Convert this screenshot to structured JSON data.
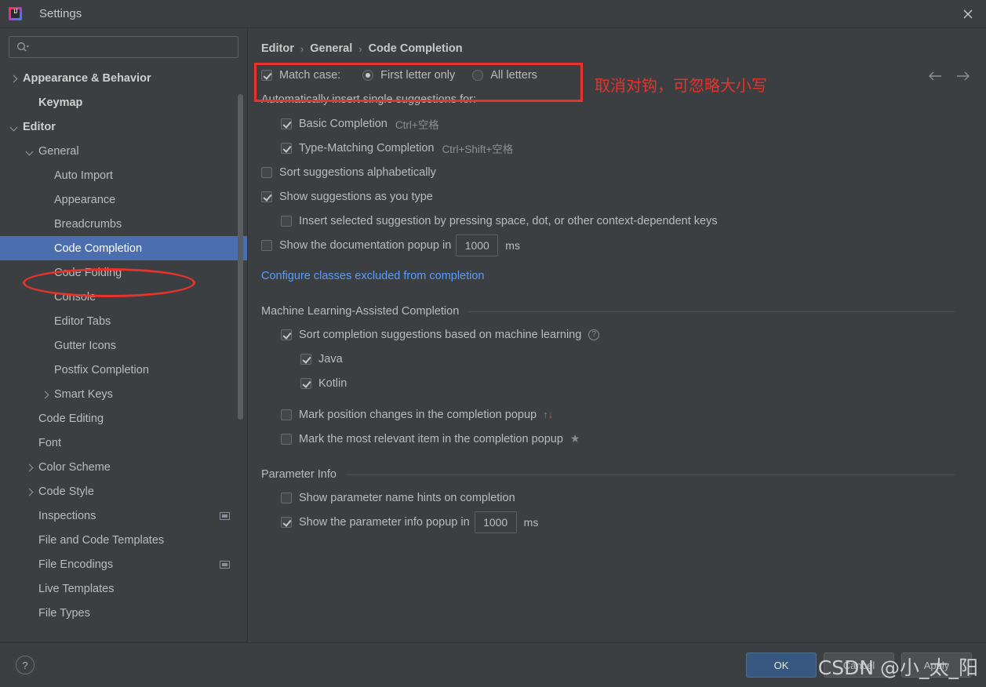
{
  "window": {
    "title": "Settings",
    "app_icon": "intellij-idea-icon",
    "close_icon": "close-icon"
  },
  "sidebar": {
    "search": {
      "placeholder": "",
      "value": "",
      "icon": "search-icon"
    },
    "items": [
      {
        "label": "Appearance & Behavior",
        "arrow": "right",
        "indent": 0,
        "bold": true,
        "selected": false,
        "scope_icon": false
      },
      {
        "label": "Keymap",
        "arrow": "none",
        "indent": 1,
        "bold": true,
        "selected": false,
        "scope_icon": false
      },
      {
        "label": "Editor",
        "arrow": "down",
        "indent": 0,
        "bold": true,
        "selected": false,
        "scope_icon": false
      },
      {
        "label": "General",
        "arrow": "down",
        "indent": 1,
        "bold": false,
        "selected": false,
        "scope_icon": false
      },
      {
        "label": "Auto Import",
        "arrow": "none",
        "indent": 2,
        "bold": false,
        "selected": false,
        "scope_icon": false
      },
      {
        "label": "Appearance",
        "arrow": "none",
        "indent": 2,
        "bold": false,
        "selected": false,
        "scope_icon": false
      },
      {
        "label": "Breadcrumbs",
        "arrow": "none",
        "indent": 2,
        "bold": false,
        "selected": false,
        "scope_icon": false
      },
      {
        "label": "Code Completion",
        "arrow": "none",
        "indent": 2,
        "bold": false,
        "selected": true,
        "scope_icon": false
      },
      {
        "label": "Code Folding",
        "arrow": "none",
        "indent": 2,
        "bold": false,
        "selected": false,
        "scope_icon": false
      },
      {
        "label": "Console",
        "arrow": "none",
        "indent": 2,
        "bold": false,
        "selected": false,
        "scope_icon": false
      },
      {
        "label": "Editor Tabs",
        "arrow": "none",
        "indent": 2,
        "bold": false,
        "selected": false,
        "scope_icon": false
      },
      {
        "label": "Gutter Icons",
        "arrow": "none",
        "indent": 2,
        "bold": false,
        "selected": false,
        "scope_icon": false
      },
      {
        "label": "Postfix Completion",
        "arrow": "none",
        "indent": 2,
        "bold": false,
        "selected": false,
        "scope_icon": false
      },
      {
        "label": "Smart Keys",
        "arrow": "right",
        "indent": 2,
        "bold": false,
        "selected": false,
        "scope_icon": false
      },
      {
        "label": "Code Editing",
        "arrow": "none",
        "indent": 1,
        "bold": false,
        "selected": false,
        "scope_icon": false
      },
      {
        "label": "Font",
        "arrow": "none",
        "indent": 1,
        "bold": false,
        "selected": false,
        "scope_icon": false
      },
      {
        "label": "Color Scheme",
        "arrow": "right",
        "indent": 1,
        "bold": false,
        "selected": false,
        "scope_icon": false
      },
      {
        "label": "Code Style",
        "arrow": "right",
        "indent": 1,
        "bold": false,
        "selected": false,
        "scope_icon": false
      },
      {
        "label": "Inspections",
        "arrow": "none",
        "indent": 1,
        "bold": false,
        "selected": false,
        "scope_icon": true
      },
      {
        "label": "File and Code Templates",
        "arrow": "none",
        "indent": 1,
        "bold": false,
        "selected": false,
        "scope_icon": false
      },
      {
        "label": "File Encodings",
        "arrow": "none",
        "indent": 1,
        "bold": false,
        "selected": false,
        "scope_icon": true
      },
      {
        "label": "Live Templates",
        "arrow": "none",
        "indent": 1,
        "bold": false,
        "selected": false,
        "scope_icon": false
      },
      {
        "label": "File Types",
        "arrow": "none",
        "indent": 1,
        "bold": false,
        "selected": false,
        "scope_icon": false
      }
    ]
  },
  "content": {
    "breadcrumb": [
      "Editor",
      "General",
      "Code Completion"
    ],
    "breadcrumb_separator": "›",
    "nav": {
      "back_icon": "arrow-left-icon",
      "forward_icon": "arrow-right-icon"
    },
    "match_case": {
      "label": "Match case:",
      "checked": true,
      "options": [
        {
          "label": "First letter only",
          "selected": true
        },
        {
          "label": "All letters",
          "selected": false
        }
      ]
    },
    "auto_insert_label": "Automatically insert single suggestions for:",
    "auto_insert_items": [
      {
        "label": "Basic Completion",
        "shortcut": "Ctrl+空格",
        "checked": true
      },
      {
        "label": "Type-Matching Completion",
        "shortcut": "Ctrl+Shift+空格",
        "checked": true
      }
    ],
    "sort_alphabetically": {
      "label": "Sort suggestions alphabetically",
      "checked": false
    },
    "show_as_you_type": {
      "label": "Show suggestions as you type",
      "checked": true
    },
    "insert_selected": {
      "label": "Insert selected suggestion by pressing space, dot, or other context-dependent keys",
      "checked": false
    },
    "doc_popup": {
      "label": "Show the documentation popup in",
      "checked": false,
      "value": "1000",
      "unit": "ms"
    },
    "excluded_link": "Configure classes excluded from completion",
    "ml_section": {
      "title": "Machine Learning-Assisted Completion",
      "sort_ml": {
        "label": "Sort completion suggestions based on machine learning",
        "checked": true,
        "help_icon": "help-icon",
        "help_glyph": "?"
      },
      "languages": [
        {
          "label": "Java",
          "checked": true
        },
        {
          "label": "Kotlin",
          "checked": true
        }
      ],
      "mark_position": {
        "label": "Mark position changes in the completion popup",
        "checked": false,
        "up_glyph": "↑",
        "down_glyph": "↓"
      },
      "mark_relevant": {
        "label": "Mark the most relevant item in the completion popup",
        "checked": false,
        "star_glyph": "★"
      }
    },
    "param_section": {
      "title": "Parameter Info",
      "name_hints": {
        "label": "Show parameter name hints on completion",
        "checked": false
      },
      "info_popup": {
        "label": "Show the parameter info popup in",
        "checked": true,
        "value": "1000",
        "unit": "ms"
      }
    }
  },
  "annotations": {
    "chinese_note": "取消对钩，可忽略大小写",
    "highlight_color": "#e8322b"
  },
  "footer": {
    "help_glyph": "?",
    "buttons": [
      {
        "label": "OK",
        "style": "primary"
      },
      {
        "label": "Cancel",
        "style": "normal"
      },
      {
        "label": "Apply",
        "style": "normal"
      }
    ]
  },
  "watermark": {
    "text": "CSDN @小_太_阳"
  }
}
